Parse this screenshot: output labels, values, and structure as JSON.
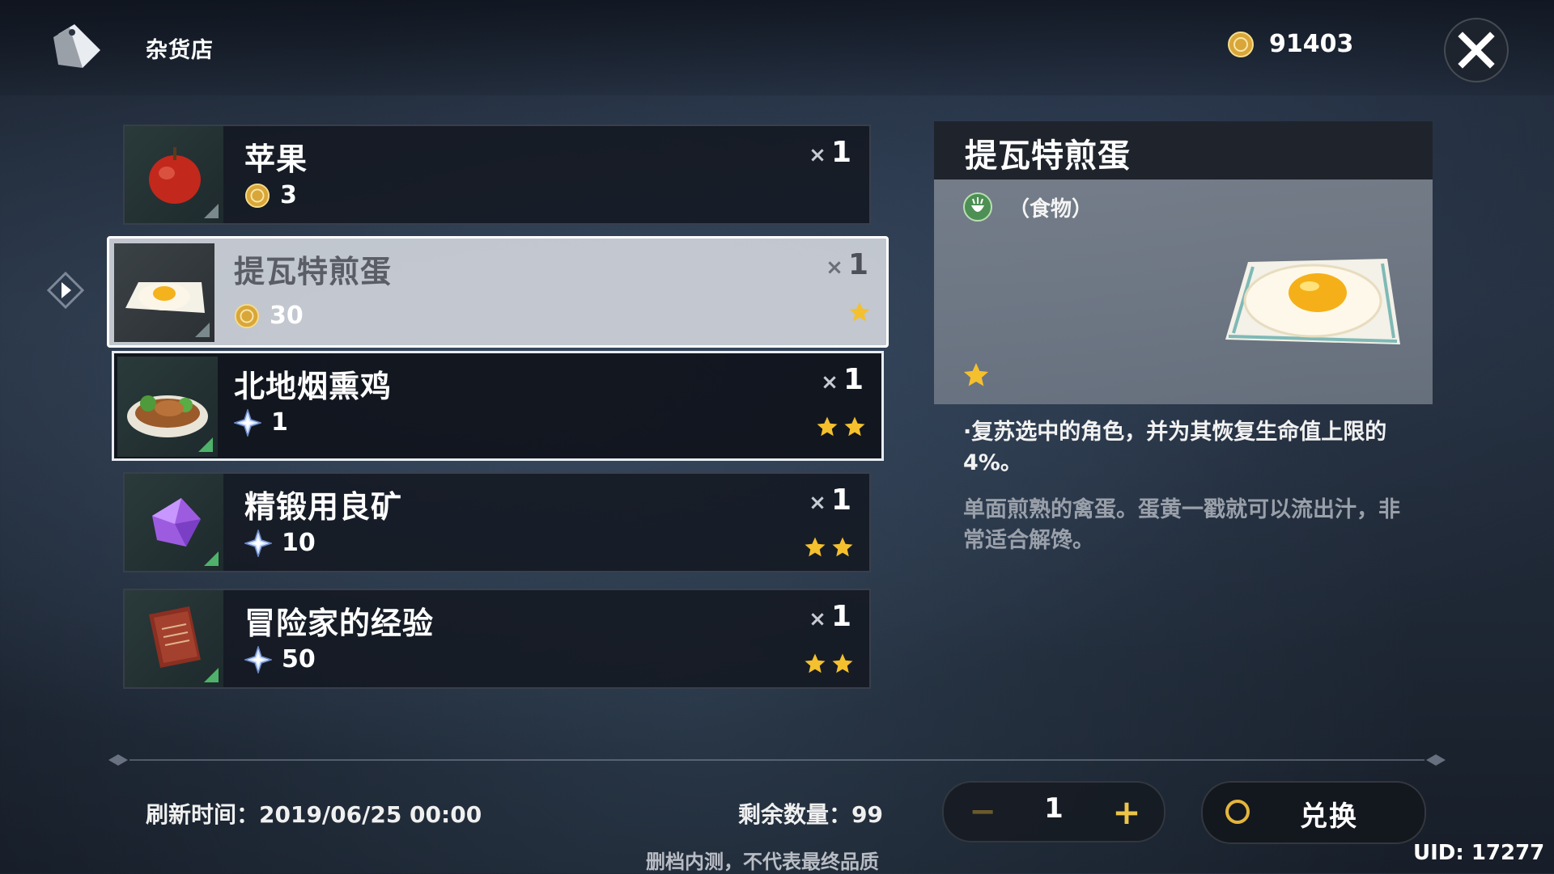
{
  "header": {
    "shop_title": "杂货店",
    "currency_icon": "mora-coin-icon",
    "currency_value": "91403",
    "close_icon": "close-icon"
  },
  "items": [
    {
      "name": "苹果",
      "qty_prefix": "×",
      "qty": "1",
      "price": "3",
      "price_icon": "mora-coin-icon",
      "stars": 0,
      "icon": "apple-icon"
    },
    {
      "name": "提瓦特煎蛋",
      "qty_prefix": "×",
      "qty": "1",
      "price": "30",
      "price_icon": "mora-coin-icon",
      "stars": 1,
      "icon": "fried-egg-icon"
    },
    {
      "name": "北地烟熏鸡",
      "qty_prefix": "×",
      "qty": "1",
      "price": "1",
      "price_icon": "primogem-icon",
      "stars": 2,
      "icon": "smoked-chicken-icon"
    },
    {
      "name": "精锻用良矿",
      "qty_prefix": "×",
      "qty": "1",
      "price": "10",
      "price_icon": "primogem-icon",
      "stars": 2,
      "icon": "enhancement-ore-icon"
    },
    {
      "name": "冒险家的经验",
      "qty_prefix": "×",
      "qty": "1",
      "price": "50",
      "price_icon": "primogem-icon",
      "stars": 2,
      "icon": "adventurer-experience-icon"
    }
  ],
  "detail": {
    "title": "提瓦特煎蛋",
    "type_label": "（食物）",
    "type_icon": "food-icon",
    "stars": 1,
    "effect": "·复苏选中的角色，并为其恢复生命值上限的4%。",
    "flavor": "单面煎熟的禽蛋。蛋黄一戳就可以流出汁，非常适合解馋。"
  },
  "footer": {
    "refresh_label": "刷新时间：2019/06/25 00:00",
    "remaining_label": "剩余数量：99",
    "quantity": "1",
    "minus_symbol": "−",
    "plus_symbol": "+",
    "exchange_label": "兑换",
    "notice": "删档内测，不代表最终品质",
    "uid": "UID: 17277"
  },
  "colors": {
    "gold": "#ecc44a",
    "star": "#f5c02e",
    "rarity_green": "#4eb26a",
    "selected_bg": "#ced2da"
  }
}
